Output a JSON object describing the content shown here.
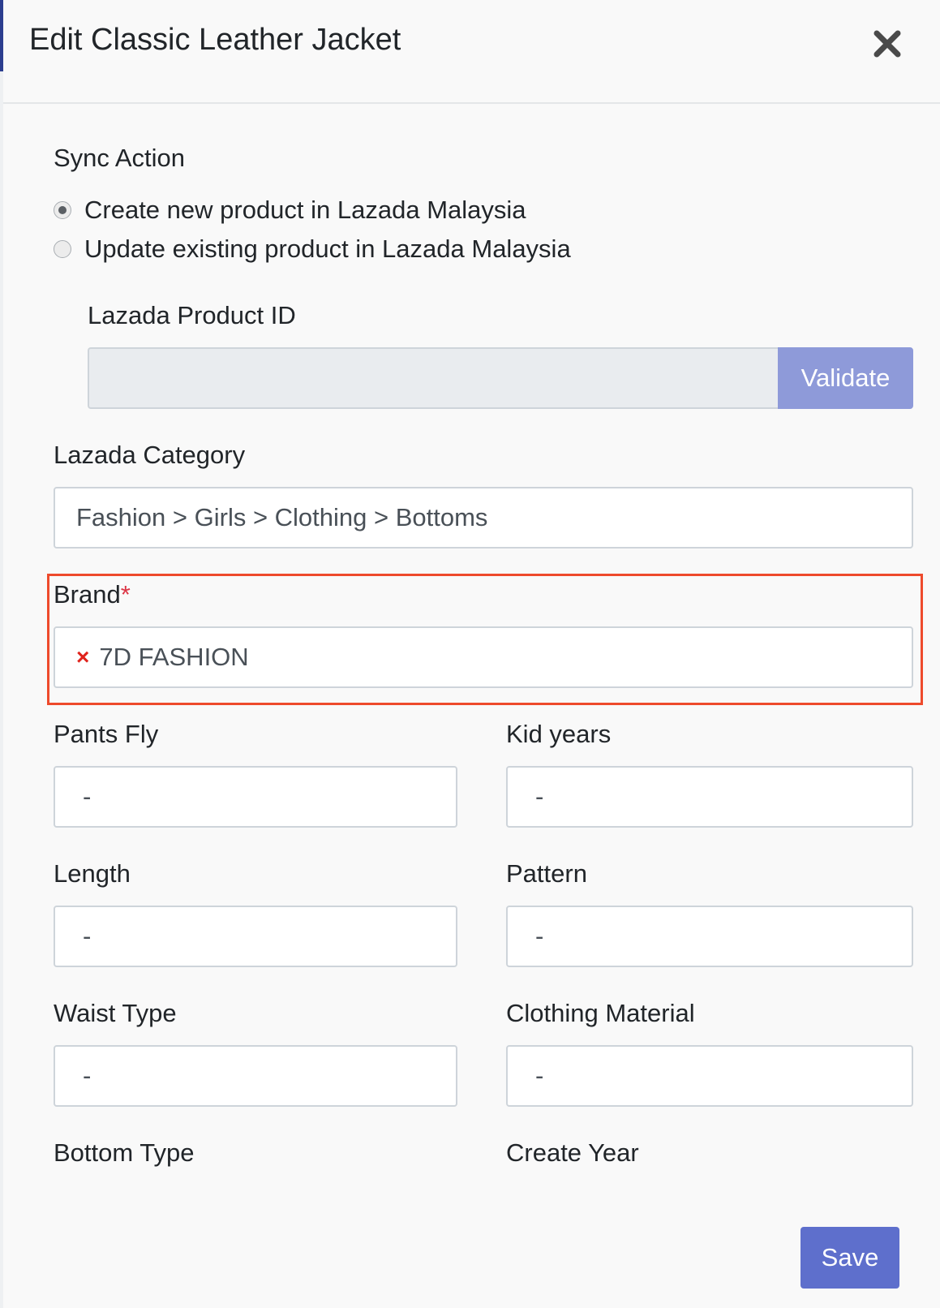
{
  "modal": {
    "title": "Edit Classic Leather Jacket"
  },
  "sync_action": {
    "label": "Sync Action",
    "options": [
      {
        "label": "Create new product in Lazada Malaysia",
        "checked": true
      },
      {
        "label": "Update existing product in Lazada Malaysia",
        "checked": false
      }
    ]
  },
  "product_id": {
    "label": "Lazada Product ID",
    "value": "",
    "validate_label": "Validate"
  },
  "category": {
    "label": "Lazada Category",
    "value": "Fashion > Girls > Clothing > Bottoms"
  },
  "brand": {
    "label": "Brand",
    "required_mark": "*",
    "remove_symbol": "×",
    "value": "7D FASHION"
  },
  "fields": {
    "pants_fly": {
      "label": "Pants Fly",
      "value": "-"
    },
    "kid_years": {
      "label": "Kid years",
      "value": "-"
    },
    "length": {
      "label": "Length",
      "value": "-"
    },
    "pattern": {
      "label": "Pattern",
      "value": "-"
    },
    "waist_type": {
      "label": "Waist Type",
      "value": "-"
    },
    "clothing_material": {
      "label": "Clothing Material",
      "value": "-"
    },
    "bottom_type": {
      "label": "Bottom Type"
    },
    "create_year": {
      "label": "Create Year"
    }
  },
  "footer": {
    "save_label": "Save"
  },
  "colors": {
    "primary": "#5e6fcc",
    "validate": "#8e9ad9",
    "required": "#dc3545",
    "highlight": "#ee4a2c"
  }
}
